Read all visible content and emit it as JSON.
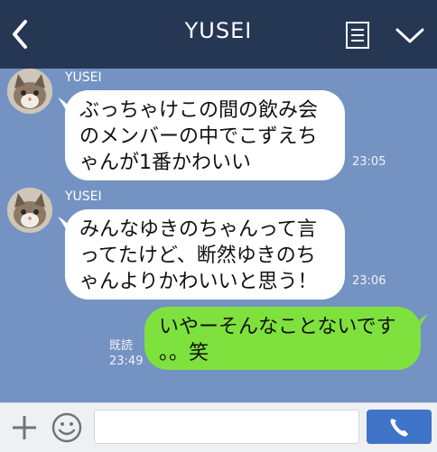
{
  "header": {
    "title": "YUSEI",
    "back_icon": "chevron-left-icon",
    "menu_icon": "note-list-icon",
    "more_icon": "chevron-down-icon",
    "background": "#263754"
  },
  "messages": [
    {
      "sender": "YUSEI",
      "lines": [
        "ぶっちゃけこの間の飲み会",
        "のメンバーの中でこずえち",
        "ゃんが1番かわいい"
      ],
      "time": "23:05"
    },
    {
      "sender": "YUSEI",
      "lines": [
        "みんなゆきのちゃんって言",
        "ってたけど、断然ゆきのち",
        "ゃんよりかわいいと思う！"
      ],
      "time": "23:06"
    },
    {
      "lines": [
        "いやーそんなことないです",
        "。。笑"
      ],
      "read_label": "既読",
      "time": "23:49"
    }
  ],
  "colors": {
    "chat_background": "#7493c3",
    "incoming_bubble": "#ffffff",
    "outgoing_bubble": "#7fe13d",
    "send_button": "#3f74c8"
  },
  "footer": {
    "plus_icon": "plus-icon",
    "emoji_icon": "smiley-icon",
    "input_value": "",
    "call_icon": "phone-icon"
  }
}
